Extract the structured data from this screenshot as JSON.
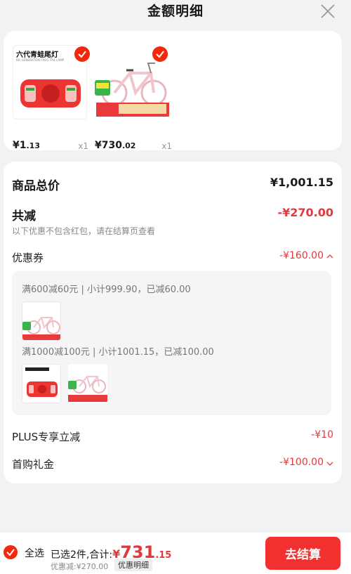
{
  "header": {
    "title": "金额明细"
  },
  "products": [
    {
      "label": "六代青蛙尾灯",
      "sublabel": "6th GENERATION FROG TAIL LAMP",
      "price_int": "¥1",
      "price_dec": ".13",
      "qty": "x1"
    },
    {
      "price_int": "¥730",
      "price_dec": ".02",
      "qty": "x1"
    }
  ],
  "summary": {
    "total_label": "商品总价",
    "total_value": "¥1,001.15",
    "reduce_label": "共减",
    "reduce_value": "-¥270.00",
    "note": "以下优惠不包含红包，请在结算页查看"
  },
  "coupon": {
    "label": "优惠券",
    "value": "-¥160.00",
    "rule1": "满600减60元 | 小计999.90，已减60.00",
    "rule2": "满1000减100元 | 小计1001.15，已减100.00"
  },
  "plus": {
    "label": "PLUS专享立减",
    "value": "-¥10"
  },
  "gift": {
    "label": "首购礼金",
    "value": "-¥100.00"
  },
  "bottom": {
    "select_all": "全选",
    "selected_prefix": "已选2件,合计:",
    "currency": "¥",
    "total_int": "731",
    "total_dec": ".15",
    "discount": "优惠减:¥270.00",
    "detail_btn": "优惠明细",
    "checkout": "去结算"
  },
  "colors": {
    "accent": "#f2270c",
    "price_red": "#e4393c"
  }
}
